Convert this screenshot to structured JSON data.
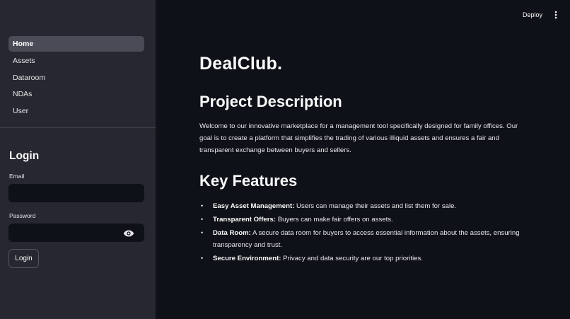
{
  "sidebar": {
    "nav": [
      {
        "label": "Home",
        "active": true
      },
      {
        "label": "Assets",
        "active": false
      },
      {
        "label": "Dataroom",
        "active": false
      },
      {
        "label": "NDAs",
        "active": false
      },
      {
        "label": "User",
        "active": false
      }
    ],
    "login": {
      "title": "Login",
      "email_label": "Email",
      "email_value": "",
      "password_label": "Password",
      "password_value": "",
      "button_label": "Login"
    }
  },
  "header": {
    "deploy_label": "Deploy",
    "menu_icon": "vertical-ellipsis-icon"
  },
  "main": {
    "brand": "DealClub.",
    "project_heading": "Project Description",
    "project_text": "Welcome to our innovative marketplace for a management tool specifically designed for family offices. Our goal is to create a platform that simplifies the trading of various illiquid assets and ensures a fair and transparent exchange between buyers and sellers.",
    "features_heading": "Key Features",
    "features": [
      {
        "title": "Easy Asset Management:",
        "text": " Users can manage their assets and list them for sale."
      },
      {
        "title": "Transparent Offers:",
        "text": " Buyers can make fair offers on assets."
      },
      {
        "title": "Data Room:",
        "text": " A secure data room for buyers to access essential information about the assets, ensuring transparency and trust."
      },
      {
        "title": "Secure Environment:",
        "text": " Privacy and data security are our top priorities."
      }
    ]
  },
  "colors": {
    "background": "#0e1117",
    "sidebar": "#262730",
    "active_nav": "#4a4b57",
    "text": "#fafafa"
  }
}
